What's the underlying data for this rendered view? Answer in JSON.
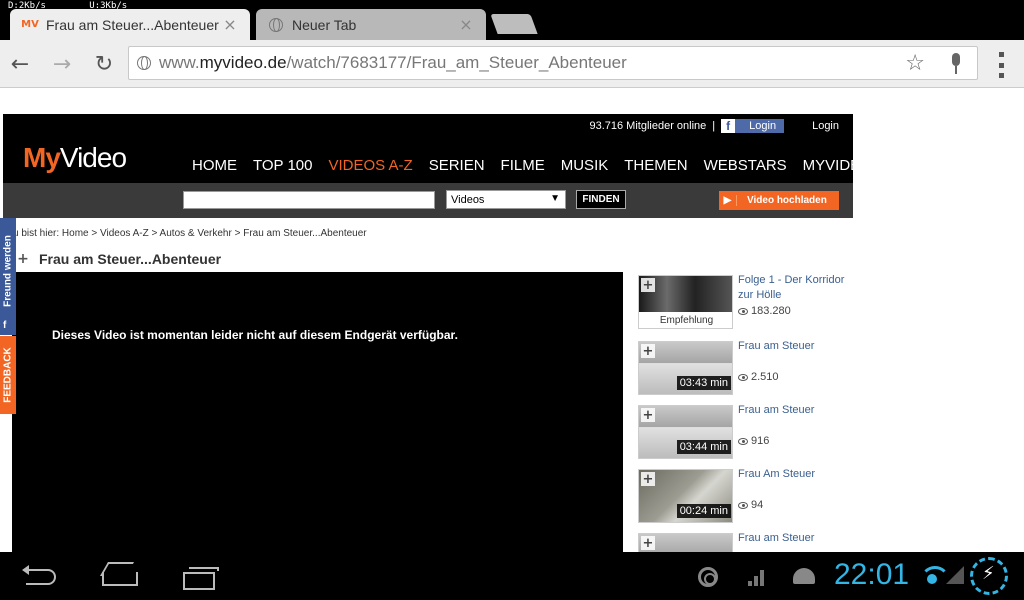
{
  "status": {
    "netstats": "D:2Kb/s        U:3Kb/s"
  },
  "tabs": [
    {
      "title": "Frau am Steuer...Abenteuer",
      "favicon": "MV",
      "close": "×"
    },
    {
      "title": "Neuer Tab",
      "close": "×"
    }
  ],
  "toolbar": {
    "url_prefix": "www.",
    "url_domain": "myvideo.de",
    "url_path": "/watch/7683177/Frau_am_Steuer_Abenteuer",
    "back": "←",
    "forward": "→",
    "reload": "↻",
    "star": "☆"
  },
  "site": {
    "members_online": "93.716 Mitglieder online",
    "separator": "|",
    "fb_icon": "f",
    "fb_login": "Login",
    "login": "Login",
    "logo_my": "My",
    "logo_video": "Video",
    "nav": [
      "HOME",
      "TOP 100",
      "VIDEOS A-Z",
      "SERIEN",
      "FILME",
      "MUSIK",
      "THEMEN",
      "WEBSTARS",
      "MYVIDEO.TV"
    ],
    "search_category": "Videos",
    "search_button": "FINDEN",
    "upload_icon": "▶",
    "upload_button": "Video hochladen",
    "side_friend": "Freund werden",
    "side_friend_icon": "f",
    "side_feedback": "FEEDBACK",
    "dropdown_arrow": "▼"
  },
  "breadcrumb": "u bist hier: Home > Videos A-Z > Autos & Verkehr > Frau am Steuer...Abenteuer",
  "video": {
    "plus": "+",
    "title": "Frau am Steuer...Abenteuer",
    "unavailable_msg": "Dieses Video ist momentan leider nicht auf diesem Endgerät verfügbar."
  },
  "related": [
    {
      "title": "Folge 1 - Der Korridor zur Hölle",
      "views": "183.280",
      "badge": "Empfehlung",
      "duration": ""
    },
    {
      "title": "Frau am Steuer",
      "views": "2.510",
      "duration": "03:43 min"
    },
    {
      "title": "Frau am Steuer",
      "views": "916",
      "duration": "03:44 min"
    },
    {
      "title": "Frau Am Steuer",
      "views": "94",
      "duration": "00:24 min"
    },
    {
      "title": "Frau am Steuer",
      "views": "",
      "duration": ""
    }
  ],
  "system": {
    "clock": "22:01"
  },
  "colors": {
    "brand_orange": "#f26522",
    "facebook_blue": "#3b5998",
    "android_holo_blue": "#33b5e5"
  }
}
